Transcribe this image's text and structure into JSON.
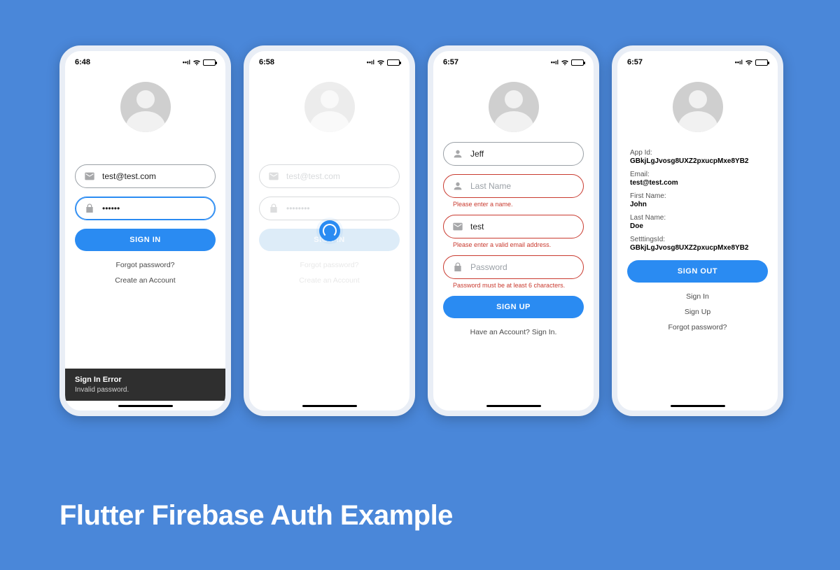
{
  "caption": "Flutter Firebase Auth Example",
  "phones": {
    "signin": {
      "time": "6:48",
      "email_value": "test@test.com",
      "password_value": "••••••",
      "signin_button": "SIGN IN",
      "forgot_link": "Forgot password?",
      "create_link": "Create an Account",
      "error_title": "Sign In Error",
      "error_message": "Invalid password."
    },
    "loading": {
      "time": "6:58",
      "email_placeholder": "test@test.com",
      "password_placeholder": "••••••••",
      "signin_button": "SIGN IN",
      "forgot_link": "Forgot password?",
      "create_link": "Create an Account"
    },
    "signup": {
      "time": "6:57",
      "first_name_value": "Jeff",
      "last_name_placeholder": "Last Name",
      "last_name_error": "Please enter a name.",
      "email_value": "test",
      "email_error": "Please enter a valid email address.",
      "password_placeholder": "Password",
      "password_error": "Password must be at least 6 characters.",
      "signup_button": "SIGN UP",
      "have_account_link": "Have an Account? Sign In."
    },
    "profile": {
      "time": "6:57",
      "appid_label": "App Id:",
      "appid_value": "GBkjLgJvosg8UXZ2pxucpMxe8YB2",
      "email_label": "Email:",
      "email_value": "test@test.com",
      "firstname_label": "First Name:",
      "firstname_value": "John",
      "lastname_label": "Last Name:",
      "lastname_value": "Doe",
      "settings_label": "SetttingsId:",
      "settings_value": "GBkjLgJvosg8UXZ2pxucpMxe8YB2",
      "signout_button": "SIGN OUT",
      "signin_link": "Sign In",
      "signup_link": "Sign Up",
      "forgot_link": "Forgot password?"
    }
  }
}
